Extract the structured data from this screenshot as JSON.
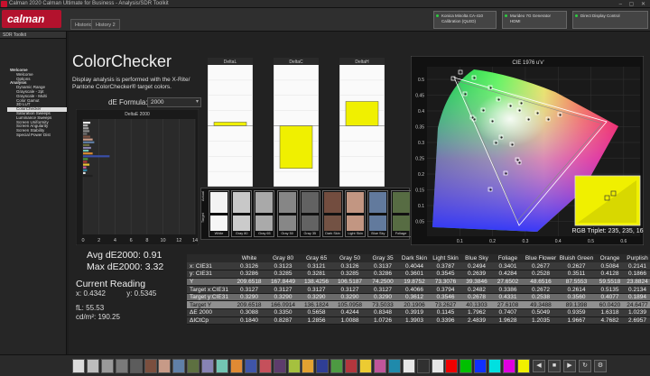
{
  "window": {
    "title": "Calman 2020 Calman Ultimate for Business - Analysis/SDR Toolkit",
    "controls": "– ▢ ✕"
  },
  "app": {
    "logo": "calman"
  },
  "tabs": [
    {
      "label": "Historic 1"
    },
    {
      "label": "History 2"
    }
  ],
  "devices": [
    {
      "line1": "Konica Minolta CA-410",
      "line2": "Calibration (QLED)"
    },
    {
      "line1": "Murideo 7G Generator",
      "line2": "HDMI"
    },
    {
      "line1": "Direct Display Control",
      "line2": ""
    }
  ],
  "sidebar": {
    "header": "SDR Toolkit",
    "items": [
      {
        "label": "Welcome",
        "level": 0
      },
      {
        "label": "Welcome",
        "level": 1
      },
      {
        "label": "Options",
        "level": 1
      },
      {
        "label": "Analysis",
        "level": 0
      },
      {
        "label": "Dynamic Range",
        "level": 1
      },
      {
        "label": "Grayscale - 2pt",
        "level": 1
      },
      {
        "label": "Grayscale - Multi",
        "level": 1
      },
      {
        "label": "Color Gamut",
        "level": 1
      },
      {
        "label": "3D LUT",
        "level": 1
      },
      {
        "label": "ColorChecker",
        "level": 1,
        "selected": true
      },
      {
        "label": "Saturation Sweeps",
        "level": 1
      },
      {
        "label": "Luminance Sweeps",
        "level": 1
      },
      {
        "label": "Screen Uniformity",
        "level": 1
      },
      {
        "label": "Screen Angularity",
        "level": 1
      },
      {
        "label": "Screen Stability",
        "level": 1
      },
      {
        "label": "Special Power Dist",
        "level": 1
      }
    ]
  },
  "page": {
    "title": "ColorChecker",
    "description": "Display analysis is performed with the X-Rite/ Pantone ColorChecker® target colors.",
    "formula_label": "dE Formula:",
    "formula_value": "2000"
  },
  "de_chart": {
    "title": "DeltaE 2000",
    "xticks": [
      "0",
      "2",
      "4",
      "6",
      "8",
      "10",
      "12",
      "14"
    ],
    "xmax": 14,
    "values": [
      0.91,
      0.6,
      0.7,
      0.8,
      0.5,
      0.9,
      1.2,
      1.4,
      0.8,
      1.0,
      0.7,
      1.2,
      3.32,
      0.6,
      0.5,
      0.8,
      0.4,
      0.5,
      0.3,
      1.2
    ],
    "colors": [
      "#f2f2f2",
      "#b3b3b3",
      "#a3a3a3",
      "#8a8a8a",
      "#707070",
      "#7a5040",
      "#c89a86",
      "#5f7ea6",
      "#6b6e3f",
      "#8983b0",
      "#71c4b2",
      "#d98a32",
      "#3a4fa7",
      "#4a953c",
      "#b53a3a",
      "#e9c232",
      "#c25a9a",
      "#2f89a8",
      "#e0e0e0",
      "#202020"
    ]
  },
  "bars": {
    "panels": [
      {
        "title": "DeltaL",
        "value": 0.12,
        "range": [
          -2,
          2
        ]
      },
      {
        "title": "DeltaC",
        "value": -1.4,
        "range": [
          -2,
          2
        ]
      },
      {
        "title": "DeltaH",
        "value": 0.8,
        "range": [
          -2,
          2
        ]
      }
    ],
    "fill_color": "#f0f000"
  },
  "swatches": {
    "actual_label": "Actual",
    "target_label": "Target",
    "items": [
      {
        "label": "White",
        "actual": "#f3f3f3",
        "target": "#f6f6f6"
      },
      {
        "label": "Gray 80",
        "actual": "#c8c8c8",
        "target": "#cbcbcb"
      },
      {
        "label": "Gray 65",
        "actual": "#a9a9a9",
        "target": "#aaaaaa"
      },
      {
        "label": "Gray 50",
        "actual": "#868686",
        "target": "#878787"
      },
      {
        "label": "Gray 35",
        "actual": "#626262",
        "target": "#636363"
      },
      {
        "label": "Dark Skin",
        "actual": "#734d3f",
        "target": "#735244"
      },
      {
        "label": "Light Skin",
        "actual": "#c29682",
        "target": "#c29682"
      },
      {
        "label": "Blue Sky",
        "actual": "#627a9d",
        "target": "#627a9d"
      },
      {
        "label": "Foliage",
        "actual": "#576c43",
        "target": "#576c43"
      }
    ]
  },
  "cie": {
    "title": "CIE 1976 u'v'",
    "rgb_triplet": "RGB Triplet: 235, 235, 16",
    "xticks": [
      "0.1",
      "0.2",
      "0.3",
      "0.4",
      "0.5",
      "0.6"
    ],
    "yticks": [
      "0.5",
      "0.45",
      "0.4",
      "0.35",
      "0.3",
      "0.25",
      "0.2",
      "0.15",
      "0.1",
      "0.05"
    ]
  },
  "summary": {
    "avg": "Avg dE2000: 0.91",
    "max": "Max dE2000: 3.32",
    "current_label": "Current Reading",
    "x": "x: 0.4342",
    "y": "y: 0.5345",
    "fl": "fL: 55.53",
    "cd": "cd/m²: 190.25"
  },
  "table": {
    "headers": [
      "",
      "White",
      "Gray 80",
      "Gray 65",
      "Gray 50",
      "Gray 35",
      "Dark Skin",
      "Light Skin",
      "Blue Sky",
      "Foliage",
      "Blue Flower",
      "Bluish Green",
      "Orange",
      "Purplish"
    ],
    "rows": [
      [
        "x: CIE31",
        "0.3126",
        "0.3123",
        "0.3121",
        "0.3126",
        "0.3137",
        "0.4044",
        "0.3787",
        "0.2494",
        "0.3401",
        "0.2677",
        "0.2627",
        "0.5084",
        "0.2141"
      ],
      [
        "y: CIE31",
        "0.3286",
        "0.3285",
        "0.3281",
        "0.3285",
        "0.3286",
        "0.3601",
        "0.3545",
        "0.2639",
        "0.4284",
        "0.2528",
        "0.3511",
        "0.4128",
        "0.1866"
      ],
      [
        "Y",
        "209.6518",
        "167.8449",
        "138.4256",
        "106.5187",
        "74.2500",
        "19.8752",
        "73.3076",
        "39.3846",
        "27.6502",
        "48.6516",
        "87.5553",
        "59.5518",
        "23.8824"
      ],
      [
        "Target x:CIE31",
        "0.3127",
        "0.3127",
        "0.3127",
        "0.3127",
        "0.3127",
        "0.4066",
        "0.3794",
        "0.2482",
        "0.3386",
        "0.2672",
        "0.2614",
        "0.5135",
        "0.2134"
      ],
      [
        "Target y:CIE31",
        "0.3290",
        "0.3290",
        "0.3290",
        "0.3290",
        "0.3290",
        "0.3612",
        "0.3546",
        "0.2678",
        "0.4331",
        "0.2538",
        "0.3560",
        "0.4077",
        "0.1894"
      ],
      [
        "Target Y",
        "209.6518",
        "166.0914",
        "136.1824",
        "105.0958",
        "73.5033",
        "20.1906",
        "73.2627",
        "40.1303",
        "27.6108",
        "49.3488",
        "89.1398",
        "60.0420",
        "24.6477"
      ],
      [
        "ΔE 2000",
        "0.3088",
        "0.3350",
        "0.5658",
        "0.4244",
        "0.8348",
        "0.3919",
        "0.1145",
        "1.7962",
        "0.7407",
        "0.5049",
        "0.9359",
        "1.6318",
        "1.0239"
      ],
      [
        "ΔICtCp",
        "0.1840",
        "0.8287",
        "1.2856",
        "1.0088",
        "1.0726",
        "1.3903",
        "0.3396",
        "2.4839",
        "1.9628",
        "1.2035",
        "1.9667",
        "4.7682",
        "2.6957"
      ]
    ]
  },
  "bottom_colors": [
    "#dcdcdc",
    "#bdbdbd",
    "#9a9a9a",
    "#7a7a7a",
    "#5c5c5c",
    "#7b4f3e",
    "#c79a87",
    "#6080a8",
    "#5d7040",
    "#8783b4",
    "#72c5b3",
    "#df8a34",
    "#3f55a8",
    "#c5505b",
    "#5d3c6c",
    "#a5c13e",
    "#e3a231",
    "#2f3e95",
    "#4d9a42",
    "#b3363d",
    "#eccb32",
    "#c0559a",
    "#1f8aab",
    "#e7e7e7",
    "#303030",
    "#e6e6e6",
    "#f00000",
    "#00c000",
    "#1030ff",
    "#00e0e0",
    "#e000e0",
    "#f0f000"
  ],
  "nav": {
    "prev": "◀",
    "stop": "■",
    "next": "▶",
    "loop": "↻",
    "settings": "⚙"
  }
}
